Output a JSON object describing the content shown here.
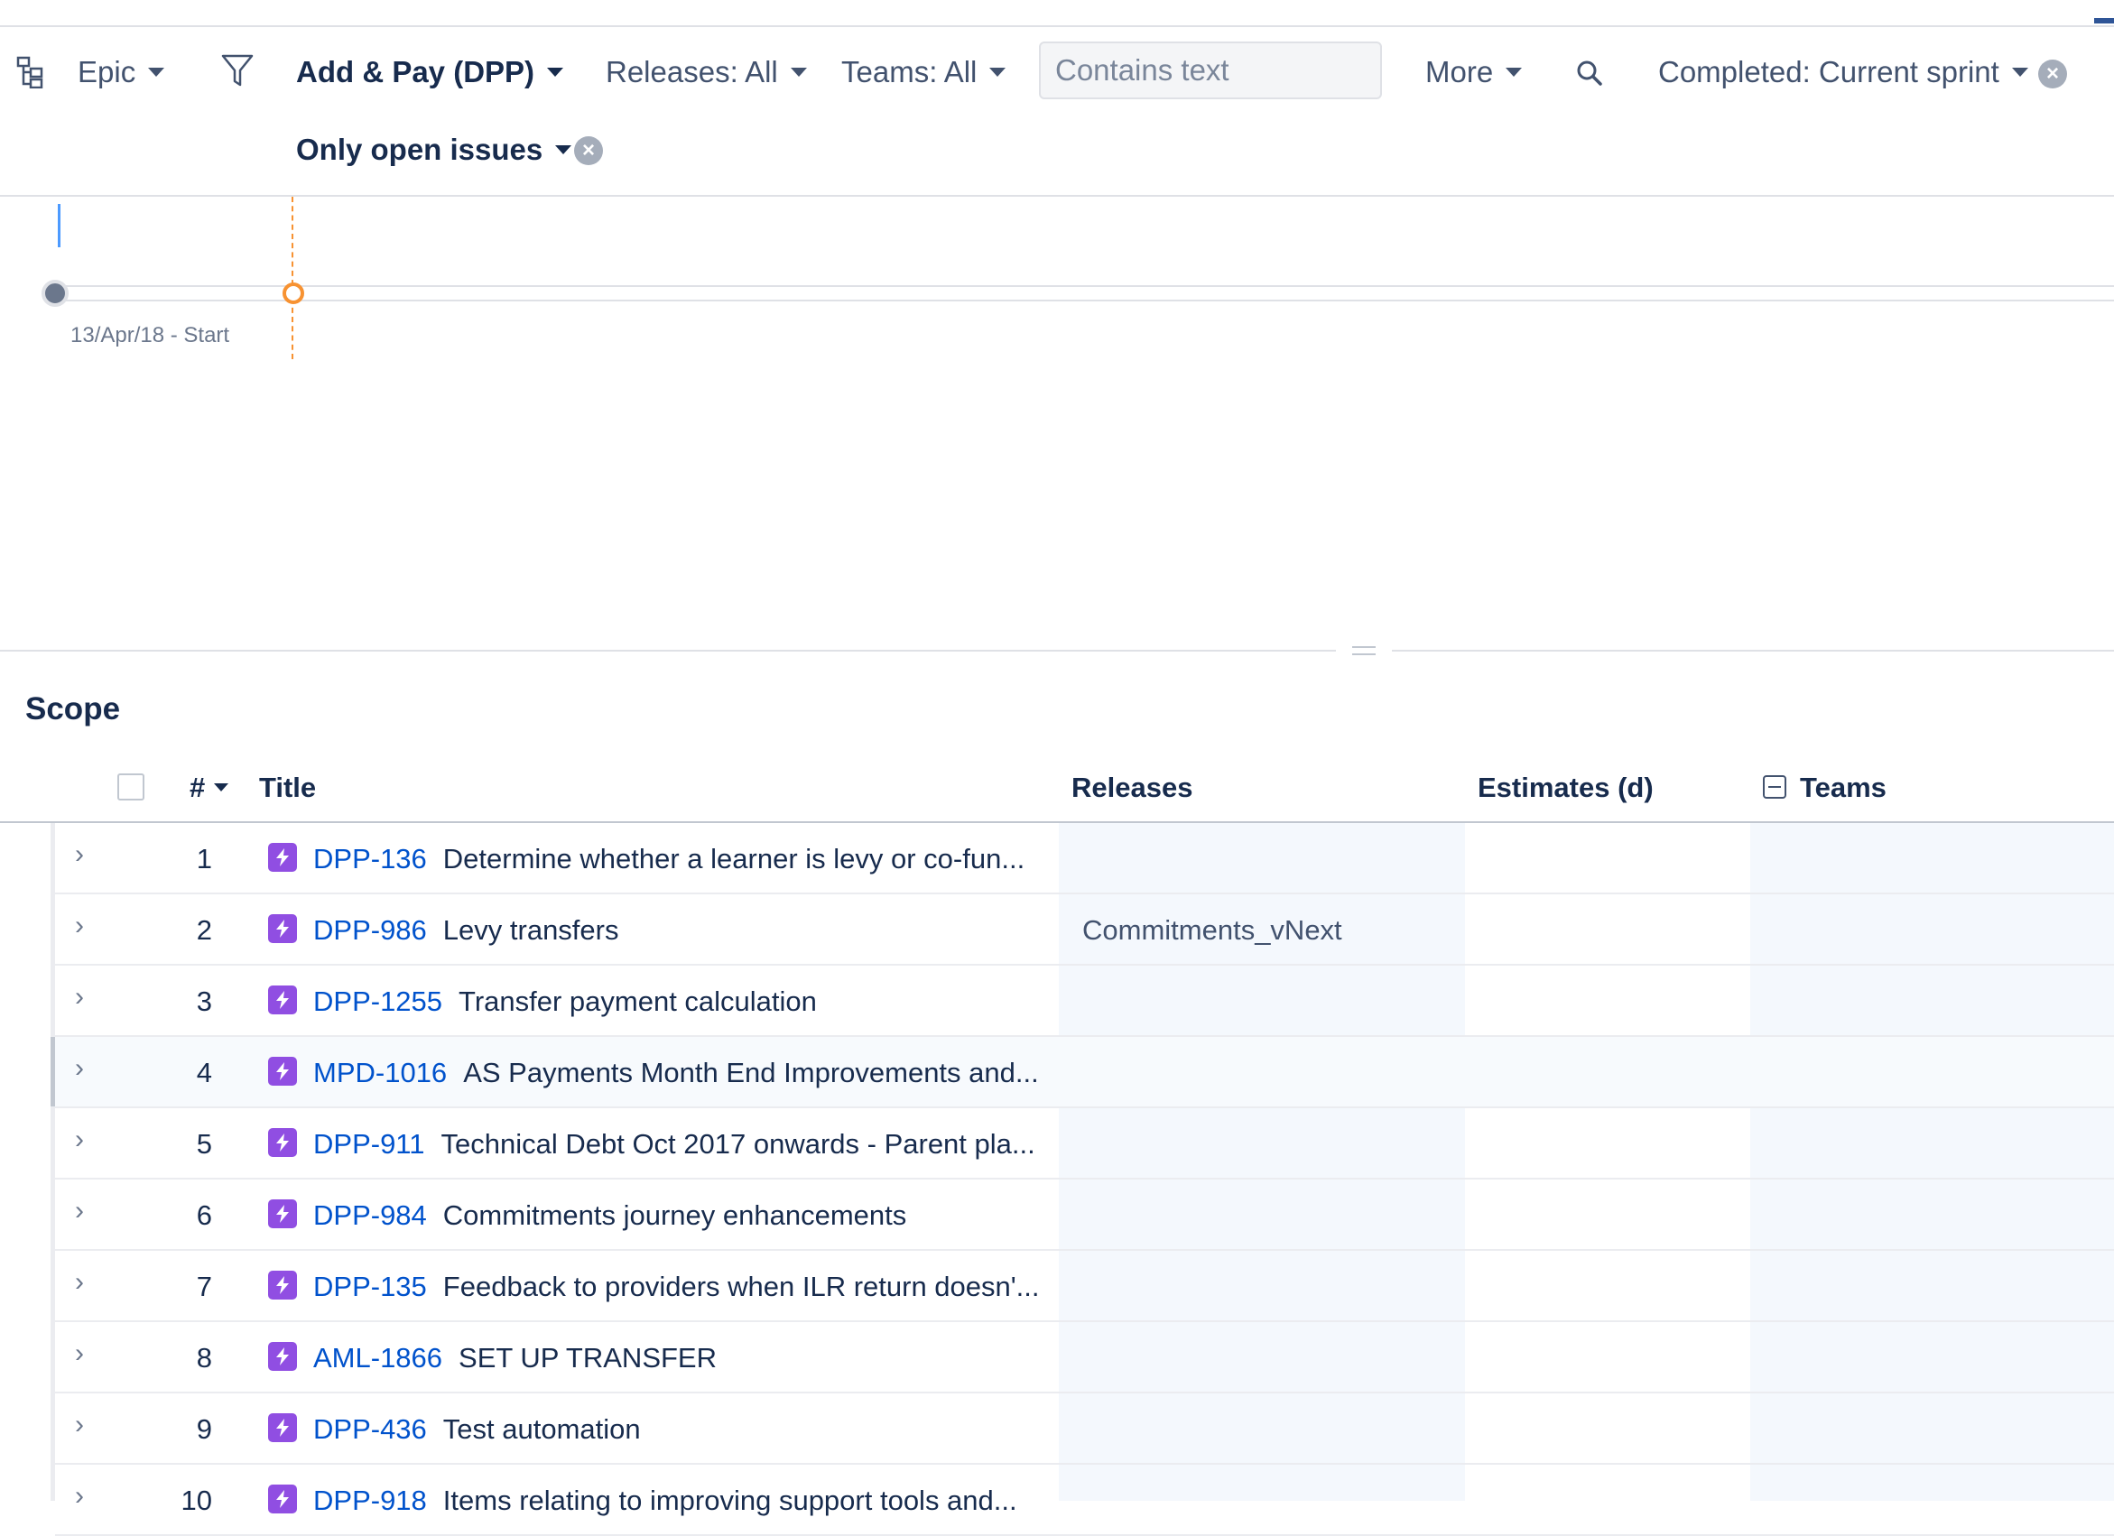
{
  "toolbar": {
    "hierarchy_label": "Epic",
    "project_label": "Add & Pay (DPP)",
    "releases_label": "Releases: All",
    "teams_label": "Teams: All",
    "search_placeholder": "Contains text",
    "more_label": "More",
    "completed_label": "Completed: Current sprint",
    "open_issues_label": "Only open issues"
  },
  "timeline": {
    "start_label": "13/Apr/18 - Start"
  },
  "scope": {
    "title": "Scope",
    "columns": {
      "number": "#",
      "title": "Title",
      "releases": "Releases",
      "estimates": "Estimates (d)",
      "teams": "Teams"
    },
    "rows": [
      {
        "num": "1",
        "key": "DPP-136",
        "summary": "Determine whether a learner is levy or co-fun...",
        "release": ""
      },
      {
        "num": "2",
        "key": "DPP-986",
        "summary": "Levy transfers",
        "release": "Commitments_vNext"
      },
      {
        "num": "3",
        "key": "DPP-1255",
        "summary": "Transfer payment calculation",
        "release": ""
      },
      {
        "num": "4",
        "key": "MPD-1016",
        "summary": "AS Payments Month End Improvements and...",
        "release": ""
      },
      {
        "num": "5",
        "key": "DPP-911",
        "summary": "Technical Debt Oct 2017 onwards - Parent pla...",
        "release": ""
      },
      {
        "num": "6",
        "key": "DPP-984",
        "summary": "Commitments journey enhancements",
        "release": ""
      },
      {
        "num": "7",
        "key": "DPP-135",
        "summary": "Feedback to providers when ILR return doesn'...",
        "release": ""
      },
      {
        "num": "8",
        "key": "AML-1866",
        "summary": "SET UP TRANSFER",
        "release": ""
      },
      {
        "num": "9",
        "key": "DPP-436",
        "summary": "Test automation",
        "release": ""
      },
      {
        "num": "10",
        "key": "DPP-918",
        "summary": "Items relating to improving support tools and...",
        "release": ""
      }
    ]
  },
  "colors": {
    "link": "#0052CC",
    "epic": "#904EE2",
    "today_marker": "#F79232"
  }
}
